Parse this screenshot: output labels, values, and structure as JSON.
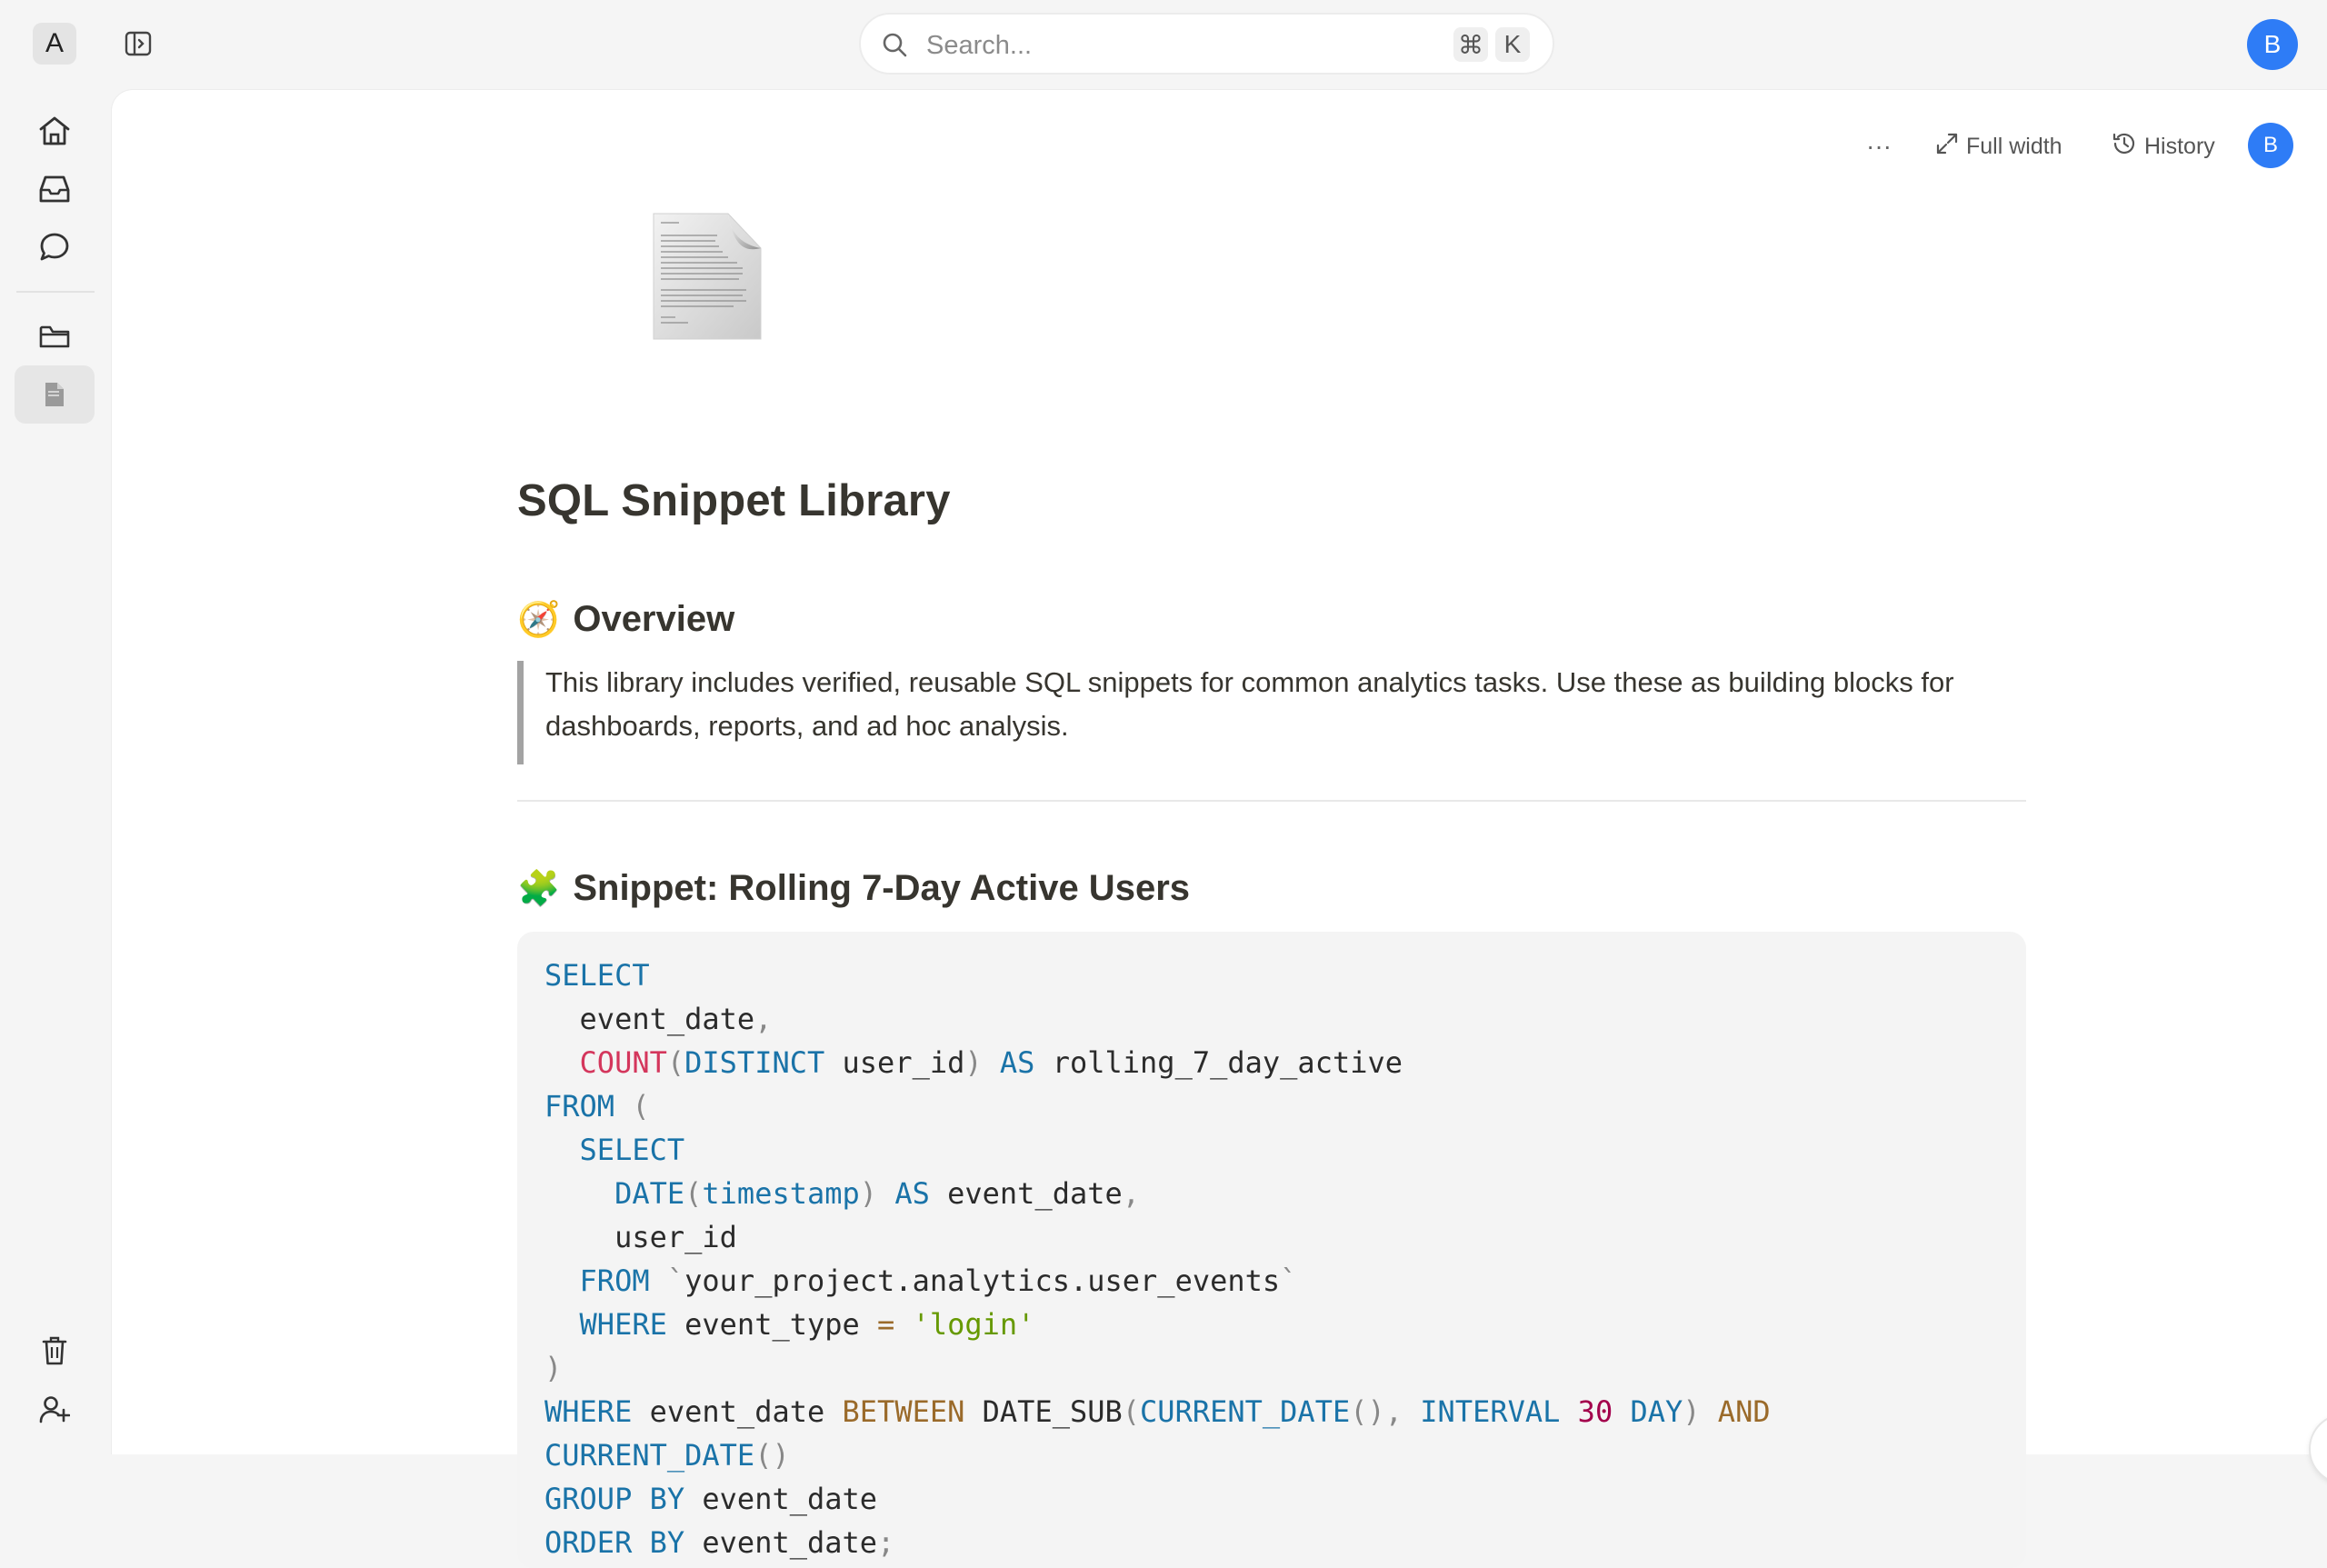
{
  "topbar": {
    "workspace_letter": "A",
    "search_placeholder": "Search...",
    "shortcut_cmd": "⌘",
    "shortcut_key": "K",
    "user_initial": "B"
  },
  "rail": {
    "items": [
      "home-icon",
      "inbox-icon",
      "chat-icon",
      "folder-icon",
      "document-icon"
    ],
    "bottom": [
      "trash-icon",
      "invite-user-icon"
    ]
  },
  "toolbar": {
    "more_label": "···",
    "full_width_label": "Full width",
    "history_label": "History",
    "user_initial": "B"
  },
  "page": {
    "title": "SQL Snippet Library",
    "overview_emoji": "🧭",
    "overview_heading": "Overview",
    "overview_text": "This library includes verified, reusable SQL snippets for common analytics tasks. Use these as building blocks for dashboards, reports, and ad hoc analysis.",
    "snippet_emoji": "🧩",
    "snippet_heading": "Snippet: Rolling 7-Day Active Users"
  },
  "code_lines": [
    [
      [
        "kw",
        "SELECT"
      ]
    ],
    [
      [
        "tx",
        "  event_date"
      ],
      [
        "pu",
        ","
      ]
    ],
    [
      [
        "tx",
        "  "
      ],
      [
        "fn",
        "COUNT"
      ],
      [
        "pu",
        "("
      ],
      [
        "kw",
        "DISTINCT"
      ],
      [
        "tx",
        " user_id"
      ],
      [
        "pu",
        ")"
      ],
      [
        "tx",
        " "
      ],
      [
        "kw",
        "AS"
      ],
      [
        "tx",
        " rolling_7_day_active"
      ]
    ],
    [
      [
        "kw",
        "FROM"
      ],
      [
        "tx",
        " "
      ],
      [
        "pu",
        "("
      ]
    ],
    [
      [
        "tx",
        "  "
      ],
      [
        "kw",
        "SELECT"
      ]
    ],
    [
      [
        "tx",
        "    "
      ],
      [
        "kw",
        "DATE"
      ],
      [
        "pu",
        "("
      ],
      [
        "kw",
        "timestamp"
      ],
      [
        "pu",
        ")"
      ],
      [
        "tx",
        " "
      ],
      [
        "kw",
        "AS"
      ],
      [
        "tx",
        " event_date"
      ],
      [
        "pu",
        ","
      ]
    ],
    [
      [
        "tx",
        "    user_id"
      ]
    ],
    [
      [
        "tx",
        "  "
      ],
      [
        "kw",
        "FROM"
      ],
      [
        "tx",
        " "
      ],
      [
        "pu",
        "`"
      ],
      [
        "tx",
        "your_project.analytics.user_events"
      ],
      [
        "pu",
        "`"
      ]
    ],
    [
      [
        "tx",
        "  "
      ],
      [
        "kw",
        "WHERE"
      ],
      [
        "tx",
        " event_type "
      ],
      [
        "op",
        "="
      ],
      [
        "tx",
        " "
      ],
      [
        "str",
        "'login'"
      ]
    ],
    [
      [
        "pu",
        ")"
      ]
    ],
    [
      [
        "kw",
        "WHERE"
      ],
      [
        "tx",
        " event_date "
      ],
      [
        "op",
        "BETWEEN"
      ],
      [
        "tx",
        " DATE_SUB"
      ],
      [
        "pu",
        "("
      ],
      [
        "kw",
        "CURRENT_DATE"
      ],
      [
        "pu",
        "(),"
      ],
      [
        "tx",
        " "
      ],
      [
        "kw",
        "INTERVAL"
      ],
      [
        "tx",
        " "
      ],
      [
        "num",
        "30"
      ],
      [
        "tx",
        " "
      ],
      [
        "kw",
        "DAY"
      ],
      [
        "pu",
        ")"
      ],
      [
        "tx",
        " "
      ],
      [
        "op",
        "AND"
      ]
    ],
    [
      [
        "kw",
        "CURRENT_DATE"
      ],
      [
        "pu",
        "()"
      ]
    ],
    [
      [
        "kw",
        "GROUP BY"
      ],
      [
        "tx",
        " event_date"
      ]
    ],
    [
      [
        "kw",
        "ORDER BY"
      ],
      [
        "tx",
        " event_date"
      ],
      [
        "pu",
        ";"
      ]
    ]
  ],
  "colors": {
    "accent": "#2e7cf6",
    "keyword": "#1a73a8",
    "function": "#d4365c",
    "operator": "#9a6a2a",
    "string": "#669900",
    "number": "#a3004c"
  }
}
